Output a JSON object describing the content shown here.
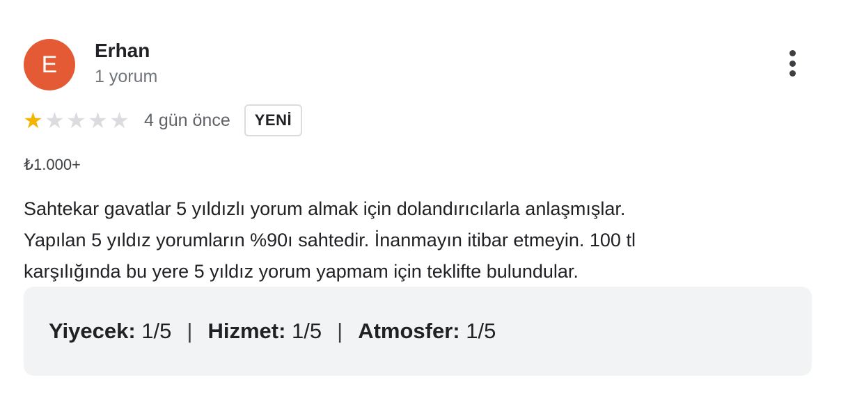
{
  "author": {
    "initial": "E",
    "name": "Erhan",
    "meta": "1 yorum",
    "avatar_color": "#e35a35"
  },
  "rating": {
    "value": 1,
    "max": 5,
    "date": "4 gün önce",
    "badge": "YENİ",
    "star_color": "#f4b400"
  },
  "price": "₺1.000+",
  "review_lines": [
    "Sahtekar gavatlar 5 yıldızlı yorum almak için dolandırıcılarla anlaşmışlar.",
    "Yapılan 5 yıldız yorumların %90ı sahtedir. İnanmayın itibar etmeyin. 100 tl",
    "karşılığında bu yere 5 yıldız yorum yapmam için teklifte bulundular."
  ],
  "subratings": {
    "food_label": "Yiyecek:",
    "food_value": "1/5",
    "service_label": "Hizmet:",
    "service_value": "1/5",
    "atmosphere_label": "Atmosfer:",
    "atmosphere_value": "1/5",
    "separator": "|"
  },
  "icons": {
    "more": "more-vert-icon",
    "star": "star-icon"
  }
}
